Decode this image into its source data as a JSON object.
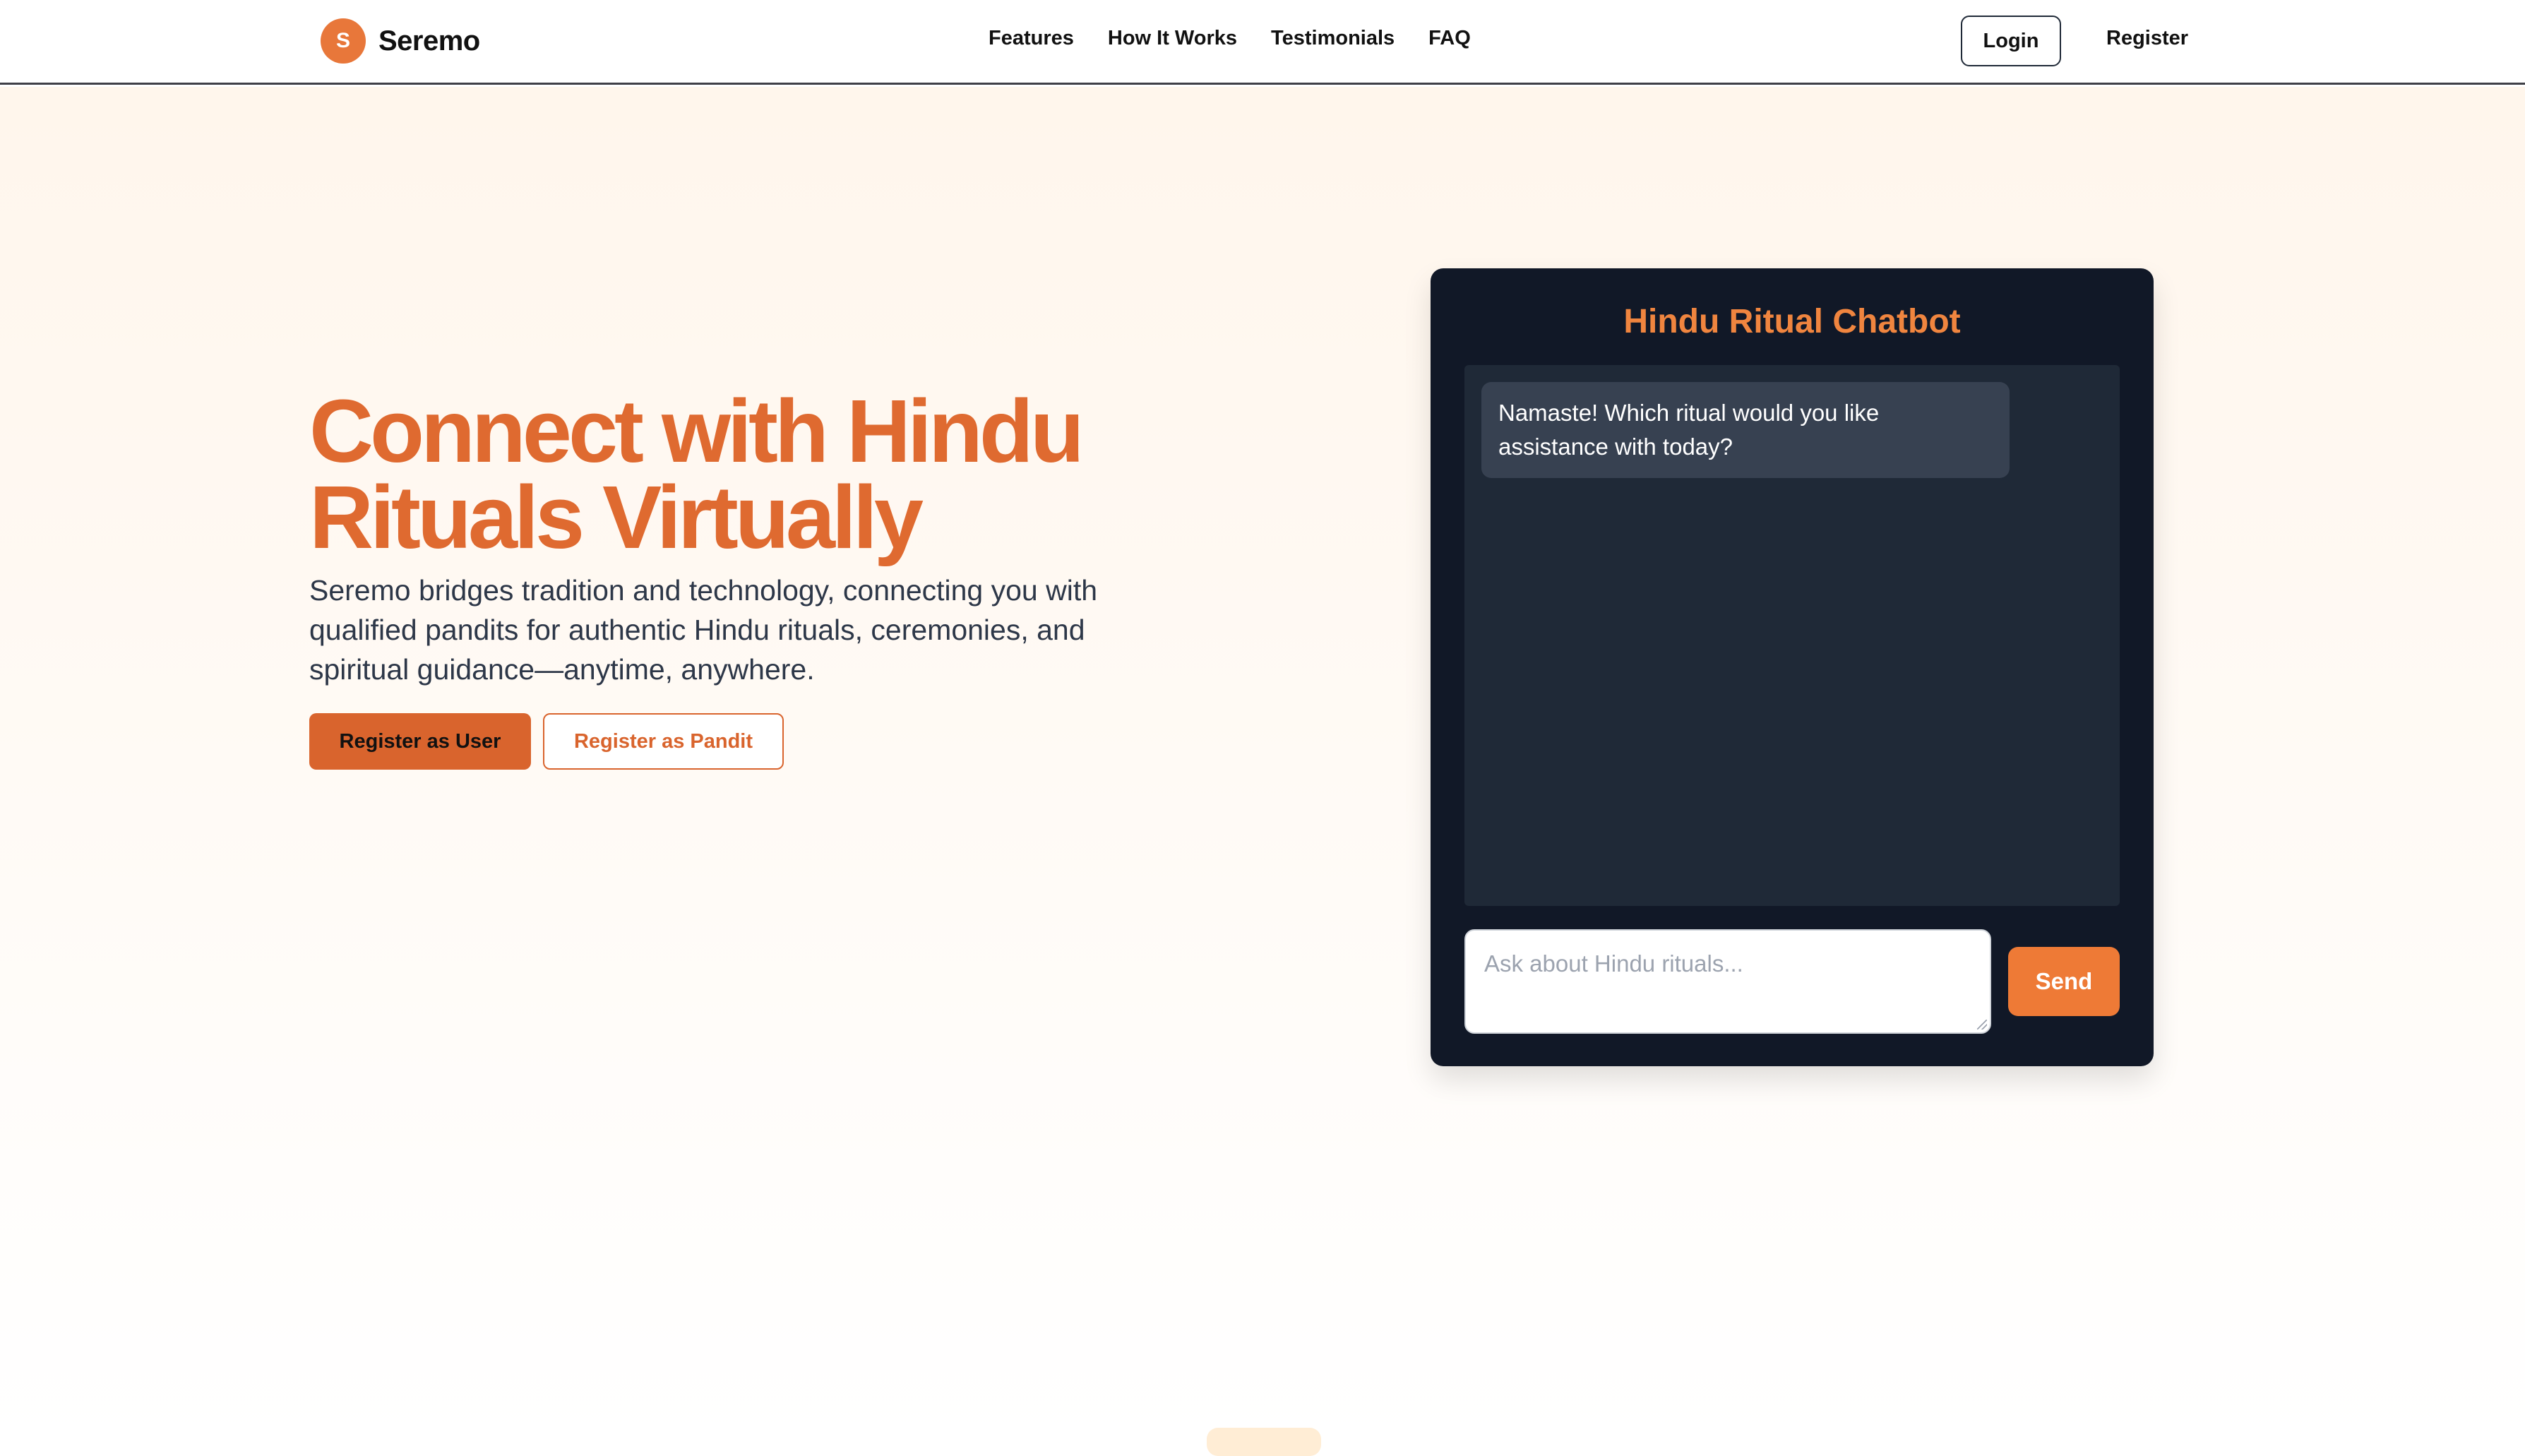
{
  "brand": {
    "initial": "S",
    "name": "Seremo",
    "accent": "#e8773a"
  },
  "nav": {
    "links": [
      "Features",
      "How It Works",
      "Testimonials",
      "FAQ"
    ],
    "login_label": "Login",
    "register_label": "Register"
  },
  "hero": {
    "title": "Connect with Hindu Rituals Virtually",
    "subtitle": "Seremo bridges tradition and technology, connecting you with qualified pandits for authentic Hindu rituals, ceremonies, and spiritual guidance—anytime, anywhere.",
    "primary_button": "Register as User",
    "secondary_button": "Register as Pandit",
    "title_color": "#df6a30"
  },
  "chatbot": {
    "title": "Hindu Ritual Chatbot",
    "messages": [
      {
        "from": "bot",
        "text": "Namaste! Which ritual would you like assistance with today?"
      }
    ],
    "input": {
      "placeholder": "Ask about Hindu rituals...",
      "value": ""
    },
    "send_label": "Send",
    "background": "#111827"
  }
}
